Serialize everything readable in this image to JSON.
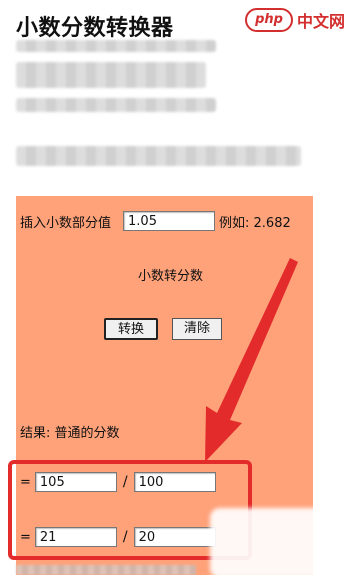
{
  "header": {
    "title": "小数分数转换器",
    "watermark": {
      "badge": "php",
      "text": "中文网"
    }
  },
  "converter": {
    "input_label": "插入小数部分值",
    "input_value": "1.05",
    "example_text": "例如: 2.682",
    "mode_label": "小数转分数",
    "convert_button": "转换",
    "clear_button": "清除",
    "result_label": "结果: 普通的分数",
    "result_rows": [
      {
        "prefix": "=",
        "numerator": "105",
        "slash": "/",
        "denominator": "100"
      },
      {
        "prefix": "=",
        "numerator": "21",
        "slash": "/",
        "denominator": "20"
      }
    ]
  },
  "annotation_colors": {
    "highlight": "#e32b2b",
    "panel": "#ffa27a",
    "watermark": "#d32f2f"
  }
}
